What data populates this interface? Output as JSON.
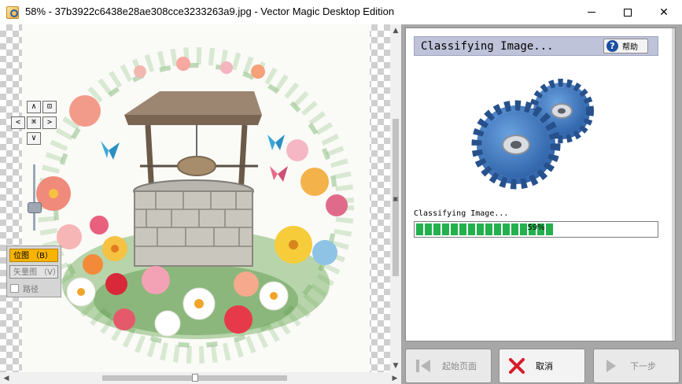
{
  "window": {
    "title": "58% - 37b3922c6438e28ae308cce3233263a9.jpg - Vector Magic Desktop Edition",
    "controls": {
      "minimize": "minimize",
      "maximize": "maximize",
      "close": "✕"
    }
  },
  "preview": {
    "nav": {
      "up": "∧",
      "down": "∨",
      "left": "<",
      "right": ">",
      "center": "⌘",
      "fit": "⊡"
    },
    "zoom_level": 0.58,
    "modes": {
      "bitmap": "位图 （B）",
      "vector": "矢量图 （V）",
      "path": "路径"
    }
  },
  "panel": {
    "title": "Classifying Image...",
    "help_label": "帮助",
    "status": "Classifying Image...",
    "progress_percent": 59,
    "progress_label": "59%"
  },
  "footer": {
    "start_page": "起始页面",
    "cancel": "取消",
    "next": "下一步"
  },
  "colors": {
    "progress_green": "#22b14c",
    "header_bg": "#bfc3d9",
    "bitmap_active": "#f8b400",
    "gear_blue": "#3b78c4",
    "cancel_red": "#d81b2a"
  }
}
